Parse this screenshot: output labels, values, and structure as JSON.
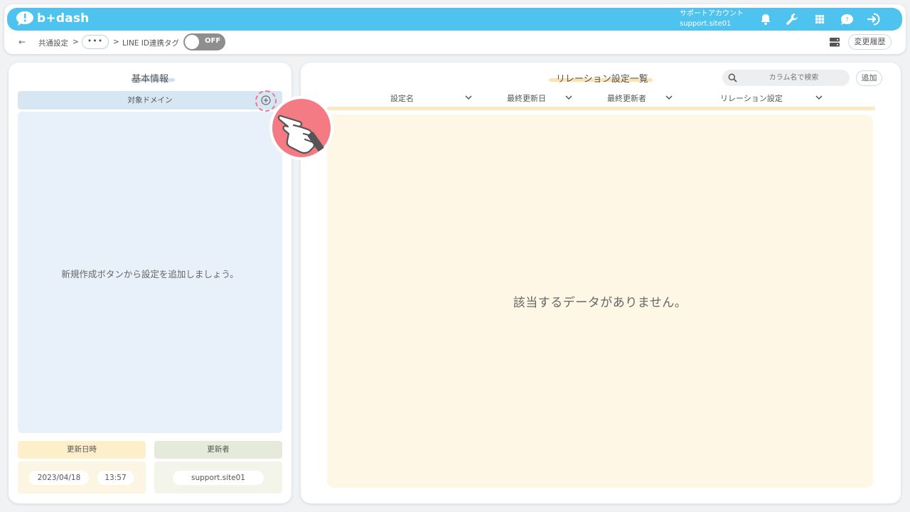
{
  "app": {
    "logo_text": "b+dash"
  },
  "account": {
    "label": "サポートアカウント",
    "name": "support.site01"
  },
  "nav_icons": [
    "bell-icon",
    "wrench-icon",
    "grid-icon",
    "help-icon",
    "logout-icon"
  ],
  "breadcrumb": {
    "back": "←",
    "item1": "共通設定",
    "sep": ">",
    "more": "•••",
    "item2": "LINE ID連携タグ"
  },
  "toggle": {
    "label": "OFF",
    "state": "off"
  },
  "history_button": "変更履歴",
  "left_panel": {
    "title": "基本情報",
    "domain_header": "対象ドメイン",
    "empty_message": "新規作成ボタンから設定を追加しましょう。",
    "updated_at_label": "更新日時",
    "updated_date": "2023/04/18",
    "updated_time": "13:57",
    "updated_by_label": "更新者",
    "updated_by": "support.site01"
  },
  "right_panel": {
    "title": "リレーション設定一覧",
    "search_placeholder": "カラム名で検索",
    "add_button": "追加",
    "columns": [
      "設定名",
      "最終更新日",
      "最終更新者",
      "リレーション設定"
    ],
    "empty_message": "該当するデータがありません。"
  },
  "colors": {
    "navbar": "#4fc3f0",
    "left_title_underline": "#cfe0ee",
    "right_title_underline": "#fbe4b0",
    "pointer": "#f07a84"
  }
}
